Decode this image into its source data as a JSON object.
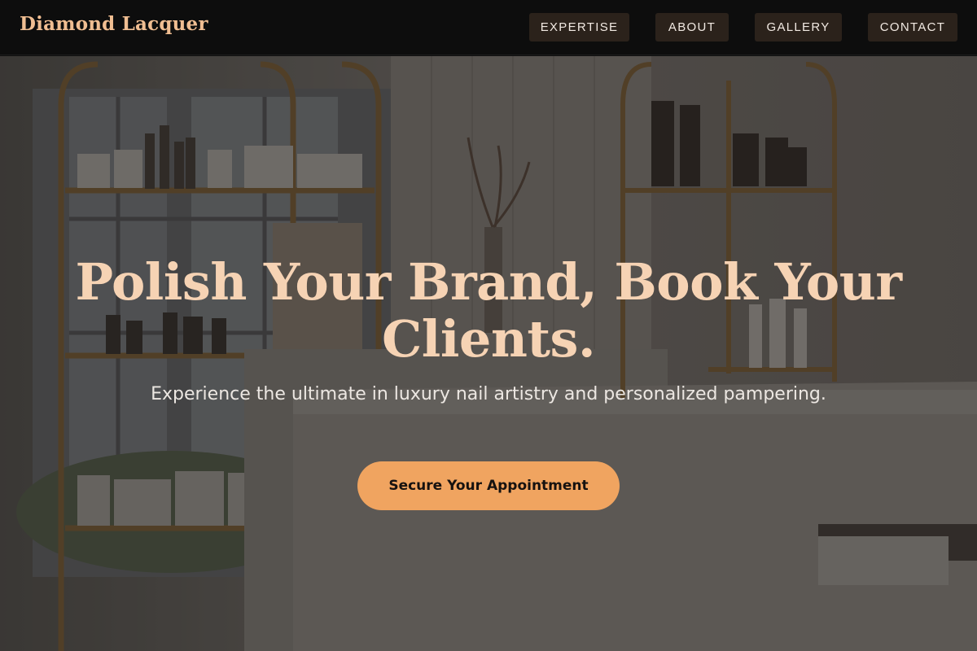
{
  "header": {
    "brand": "Diamond Lacquer",
    "nav": [
      {
        "label": "EXPERTISE"
      },
      {
        "label": "ABOUT"
      },
      {
        "label": "GALLERY"
      },
      {
        "label": "CONTACT"
      }
    ]
  },
  "hero": {
    "headline": "Polish Your Brand, Book Your Clients.",
    "subheadline": "Experience the ultimate in luxury nail artistry and personalized pampering.",
    "cta_label": "Secure Your Appointment"
  },
  "colors": {
    "header_bg": "#0d0d0d",
    "brand": "#f0be92",
    "nav_button_bg": "#2b221b",
    "headline": "#f6d3b4",
    "cta_bg": "#f0a460"
  }
}
